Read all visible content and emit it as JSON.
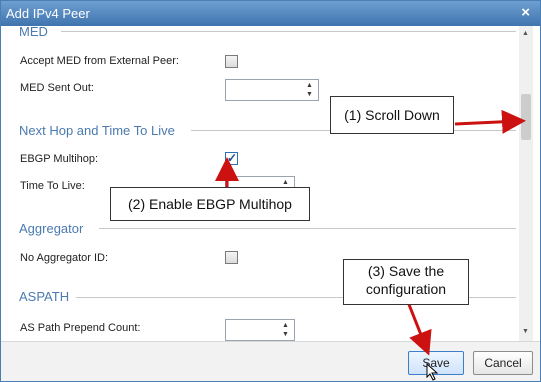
{
  "window": {
    "title": "Add IPv4 Peer",
    "close_glyph": "×"
  },
  "sections": {
    "med": {
      "title": "MED"
    },
    "next_hop": {
      "title": "Next Hop and Time To Live"
    },
    "aggregator": {
      "title": "Aggregator"
    },
    "aspath": {
      "title": "ASPATH"
    }
  },
  "fields": {
    "accept_med": {
      "label": "Accept MED from External Peer:",
      "checked": false
    },
    "med_sent_out": {
      "label": "MED Sent Out:",
      "value": ""
    },
    "ebgp_multihop": {
      "label": "EBGP Multihop:",
      "checked": true
    },
    "time_to_live": {
      "label": "Time To Live:",
      "value": ""
    },
    "no_aggregator_id": {
      "label": "No Aggregator ID:",
      "checked": false
    },
    "as_path_prepend": {
      "label": "AS Path Prepend Count:",
      "value": ""
    }
  },
  "spinner_glyphs": {
    "up": "▲",
    "down": "▼"
  },
  "scroll_glyphs": {
    "up": "▲",
    "down": "▼"
  },
  "buttons": {
    "save": "Save",
    "cancel": "Cancel"
  },
  "annotations": {
    "scroll_down": "(1) Scroll Down",
    "enable_ebgp": "(2) Enable EBGP Multihop",
    "save_line1": "(3) Save the",
    "save_line2": "configuration"
  },
  "colors": {
    "title_bar": "#3f74ad",
    "section_title": "#4a7ab0",
    "annotation_arrow": "#cc1111"
  }
}
